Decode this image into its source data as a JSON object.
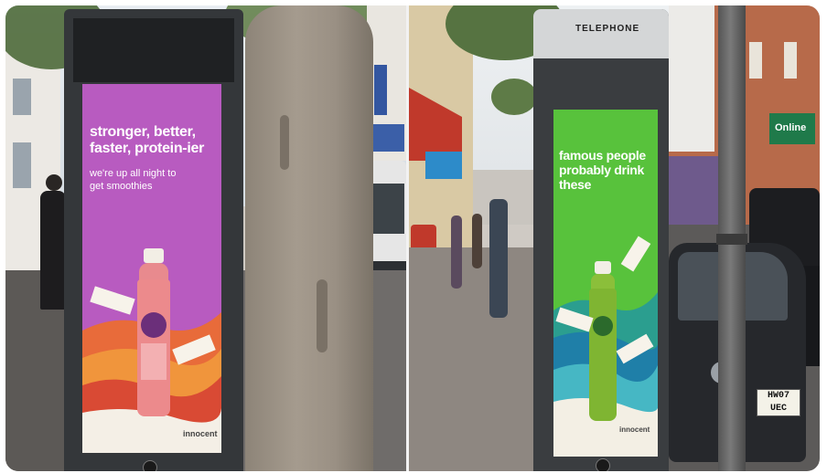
{
  "left_panel": {
    "ad": {
      "headline": "stronger, better, faster, protein-ier",
      "subline": "we're up all night to get smoothies",
      "brand": "innocent"
    }
  },
  "right_panel": {
    "kiosk_sign": "TELEPHONE",
    "ad": {
      "headline": "famous people probably drink these",
      "brand": "innocent"
    },
    "shop_sign": "Online",
    "license_plate": "HW07 UEC"
  },
  "colors": {
    "left_ad_background": "#b85bc0",
    "right_ad_background": "#58c23c",
    "kiosk_body": "#3a3d40"
  }
}
